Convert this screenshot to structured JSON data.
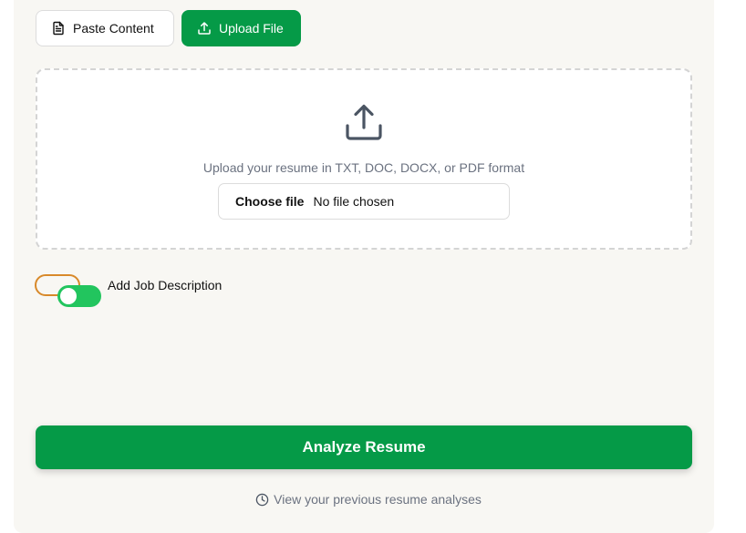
{
  "tabs": {
    "paste_label": "Paste Content",
    "upload_label": "Upload File",
    "active": "Upload File"
  },
  "dropzone": {
    "hint": "Upload your resume in TXT, DOC, DOCX, or PDF format",
    "choose_label": "Choose file",
    "file_status": "No file chosen"
  },
  "job_description_toggle": {
    "label": "Add Job Description",
    "on": true
  },
  "analyze_label": "Analyze Resume",
  "history_label": "View your previous resume analyses",
  "icons": {
    "paste": "document-icon",
    "upload": "upload-icon",
    "history": "clock-icon"
  },
  "colors": {
    "accent": "#059a47",
    "toggle_on": "#22c55e",
    "focus_ring": "#d8892a"
  }
}
